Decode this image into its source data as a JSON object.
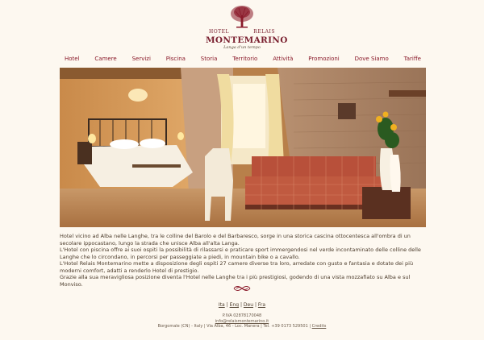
{
  "logo": {
    "hotel": "HOTEL",
    "relais": "RELAIS",
    "name": "MONTEMARINO",
    "tagline": "Langa d'un tempo",
    "tree_color": "#8a1a2a"
  },
  "nav": [
    {
      "label": "Hotel"
    },
    {
      "label": "Camere"
    },
    {
      "label": "Servizi"
    },
    {
      "label": "Piscina"
    },
    {
      "label": "Storia"
    },
    {
      "label": "Territorio"
    },
    {
      "label": "Attività"
    },
    {
      "label": "Promozioni"
    },
    {
      "label": "Dove Siamo"
    },
    {
      "label": "Tariffe"
    }
  ],
  "intro": [
    "Hotel vicino ad Alba nelle Langhe, tra le colline del Barolo e del Barbaresco, sorge in una storica cascina ottocentesca all'ombra di un secolare ippocastano, lungo la strada che unisce Alba all'alta Langa.",
    "L'Hotel con piscina offre ai suoi ospiti la possibilità di rilassarsi e praticare sport immergendosi nel verde incontaminato delle colline delle Langhe che lo circondano, in percorsi per passeggiate a piedi, in mountain bike o a cavallo.",
    "L'Hotel Relais Montemarino mette a disposizione degli ospiti 27 camere diverse tra loro, arredate con gusto e fantasia e dotate dei più moderni comfort, adatti a renderlo Hotel di prestigio.",
    "Grazie alla sua meravigliosa posizione diventa l'Hotel nelle Langhe tra i più prestigiosi, godendo di una vista mozzafiato su Alba e sul Monviso."
  ],
  "languages": {
    "ita": "Ita",
    "eng": "Eng",
    "deu": "Deu",
    "fra": "Fra",
    "sep": "|"
  },
  "footer": {
    "vat": "P.IVA 02878170048",
    "email": "info@relaismontemarino.it",
    "address": "Borgomale (CN) - Italy | Via Alba, 46 - Loc. Manera | Tel. +39 0173 529501 |",
    "credits": "Credits"
  }
}
